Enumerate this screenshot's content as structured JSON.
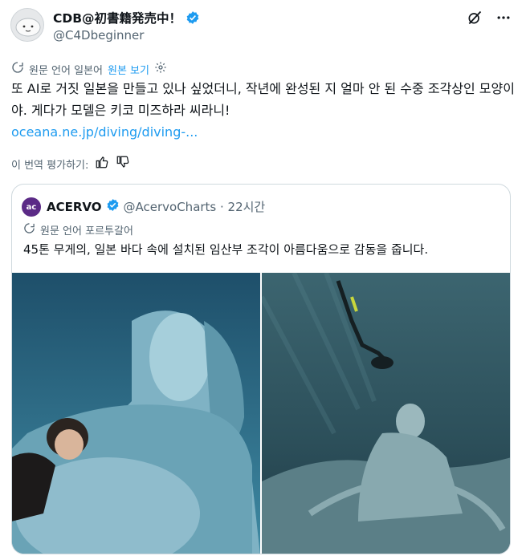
{
  "author": {
    "name": "CDB@初書籍発売中！",
    "handle": "@C4Dbeginner"
  },
  "translation_bar": {
    "label": "원문 언어 일본어",
    "show_original": "원본 보기"
  },
  "tweet": {
    "text": "또 AI로 거짓 일본을 만들고 있나 싶었더니, 작년에 완성된 지 얼마 안 된 수중 조각상인 모양이야. 게다가 모델은 키코 미즈하라 씨라니!",
    "link": "oceana.ne.jp/diving/diving-..."
  },
  "rate_translation": {
    "label": "이 번역 평가하기:"
  },
  "quote": {
    "avatar_text": "ac",
    "name": "ACERVO",
    "handle": "@AcervoCharts · 22시간",
    "translation_label": "원문 언어 포르투갈어",
    "text": "45톤 무게의, 일본 바다 속에 설치된 임산부 조각이 아름다움으로 감동을 줍니다."
  },
  "icons": {
    "verified": "verified-badge-icon",
    "grok": "grok-icon",
    "more": "more-icon",
    "translate": "translate-icon",
    "settings": "settings-icon",
    "thumbs_up": "thumbs-up-icon",
    "thumbs_down": "thumbs-down-icon"
  },
  "colors": {
    "accent": "#1d9bf0",
    "secondary_text": "#536471",
    "border": "#cfd9de",
    "water": "#2e6f86"
  }
}
